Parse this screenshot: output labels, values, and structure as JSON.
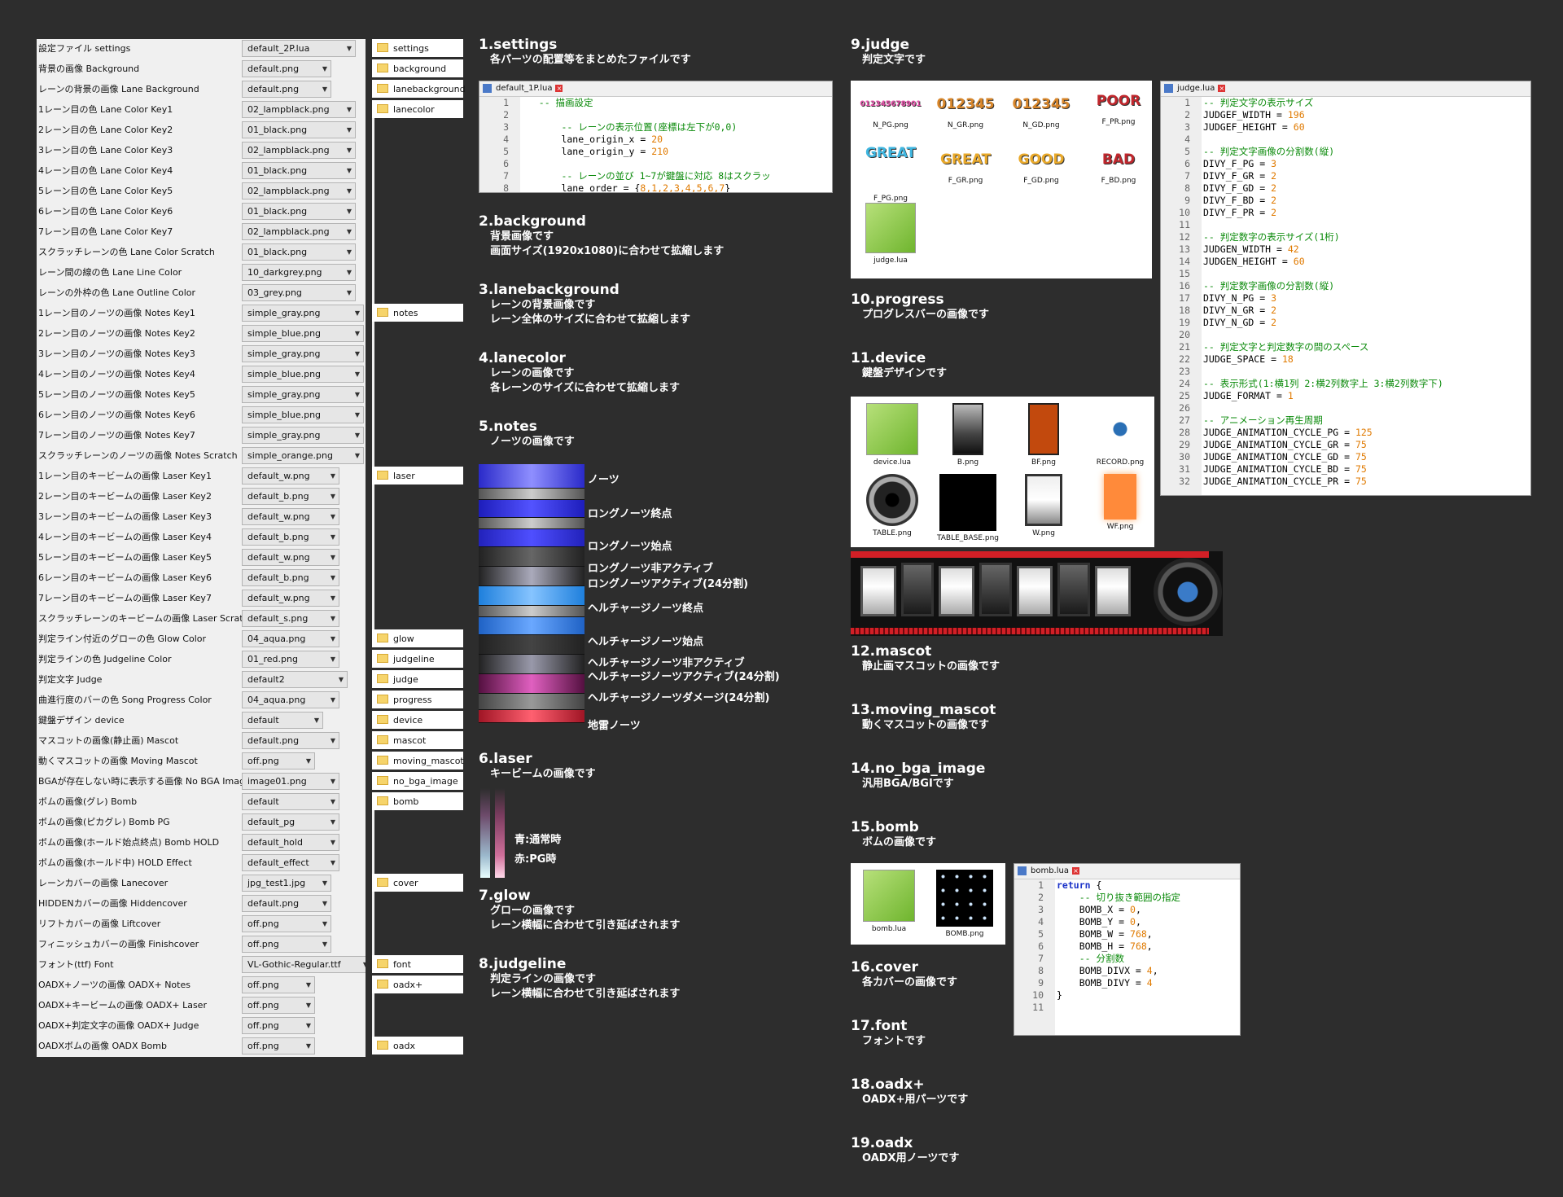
{
  "settings_rows": [
    {
      "label": "設定ファイル settings",
      "value": "default_2P.lua"
    },
    {
      "label": "背景の画像 Background",
      "value": "default.png"
    },
    {
      "label": "レーンの背景の画像 Lane Background",
      "value": "default.png"
    },
    {
      "label": "1レーン目の色 Lane Color Key1",
      "value": "02_lampblack.png"
    },
    {
      "label": "2レーン目の色 Lane Color Key2",
      "value": "01_black.png"
    },
    {
      "label": "3レーン目の色 Lane Color Key3",
      "value": "02_lampblack.png"
    },
    {
      "label": "4レーン目の色 Lane Color Key4",
      "value": "01_black.png"
    },
    {
      "label": "5レーン目の色 Lane Color Key5",
      "value": "02_lampblack.png"
    },
    {
      "label": "6レーン目の色 Lane Color Key6",
      "value": "01_black.png"
    },
    {
      "label": "7レーン目の色 Lane Color Key7",
      "value": "02_lampblack.png"
    },
    {
      "label": "スクラッチレーンの色 Lane Color Scratch",
      "value": "01_black.png"
    },
    {
      "label": "レーン間の線の色 Lane Line Color",
      "value": "10_darkgrey.png"
    },
    {
      "label": "レーンの外枠の色 Lane Outline Color",
      "value": "03_grey.png"
    },
    {
      "label": "1レーン目のノーツの画像 Notes Key1",
      "value": "simple_gray.png"
    },
    {
      "label": "2レーン目のノーツの画像 Notes Key2",
      "value": "simple_blue.png"
    },
    {
      "label": "3レーン目のノーツの画像 Notes Key3",
      "value": "simple_gray.png"
    },
    {
      "label": "4レーン目のノーツの画像 Notes Key4",
      "value": "simple_blue.png"
    },
    {
      "label": "5レーン目のノーツの画像 Notes Key5",
      "value": "simple_gray.png"
    },
    {
      "label": "6レーン目のノーツの画像 Notes Key6",
      "value": "simple_blue.png"
    },
    {
      "label": "7レーン目のノーツの画像 Notes Key7",
      "value": "simple_gray.png"
    },
    {
      "label": "スクラッチレーンのノーツの画像 Notes Scratch",
      "value": "simple_orange.png"
    },
    {
      "label": "1レーン目のキービームの画像 Laser Key1",
      "value": "default_w.png"
    },
    {
      "label": "2レーン目のキービームの画像 Laser Key2",
      "value": "default_b.png"
    },
    {
      "label": "3レーン目のキービームの画像 Laser Key3",
      "value": "default_w.png"
    },
    {
      "label": "4レーン目のキービームの画像 Laser Key4",
      "value": "default_b.png"
    },
    {
      "label": "5レーン目のキービームの画像 Laser Key5",
      "value": "default_w.png"
    },
    {
      "label": "6レーン目のキービームの画像 Laser Key6",
      "value": "default_b.png"
    },
    {
      "label": "7レーン目のキービームの画像 Laser Key7",
      "value": "default_w.png"
    },
    {
      "label": "スクラッチレーンのキービームの画像 Laser Scratch",
      "value": "default_s.png"
    },
    {
      "label": "判定ライン付近のグローの色 Glow Color",
      "value": "04_aqua.png"
    },
    {
      "label": "判定ラインの色 Judgeline Color",
      "value": "01_red.png"
    },
    {
      "label": "判定文字 Judge",
      "value": "default2"
    },
    {
      "label": "曲進行度のバーの色 Song Progress Color",
      "value": "04_aqua.png"
    },
    {
      "label": "鍵盤デザイン device",
      "value": "default"
    },
    {
      "label": "マスコットの画像(静止画) Mascot",
      "value": "default.png"
    },
    {
      "label": "動くマスコットの画像 Moving Mascot",
      "value": "off.png"
    },
    {
      "label": "BGAが存在しない時に表示する画像 No BGA Image",
      "value": "image01.png"
    },
    {
      "label": "ボムの画像(グレ) Bomb",
      "value": "default"
    },
    {
      "label": "ボムの画像(ピカグレ) Bomb PG",
      "value": "default_pg"
    },
    {
      "label": "ボムの画像(ホールド始点終点) Bomb HOLD",
      "value": "default_hold"
    },
    {
      "label": "ボムの画像(ホールド中) HOLD Effect",
      "value": "default_effect"
    },
    {
      "label": "レーンカバーの画像 Lanecover",
      "value": "jpg_test1.jpg"
    },
    {
      "label": "HIDDENカバーの画像 Hiddencover",
      "value": "default.png"
    },
    {
      "label": "リフトカバーの画像 Liftcover",
      "value": "off.png"
    },
    {
      "label": "フィニッシュカバーの画像 Finishcover",
      "value": "off.png"
    },
    {
      "label": "フォント(ttf) Font",
      "value": "VL-Gothic-Regular.ttf"
    },
    {
      "label": "OADX+ノーツの画像 OADX+ Notes",
      "value": "off.png"
    },
    {
      "label": "OADX+キービームの画像 OADX+ Laser",
      "value": "off.png"
    },
    {
      "label": "OADX+判定文字の画像 OADX+ Judge",
      "value": "off.png"
    },
    {
      "label": "OADXボムの画像 OADX Bomb",
      "value": "off.png"
    }
  ],
  "folders": [
    "settings",
    "background",
    "lanebackground",
    "lanecolor",
    "notes",
    "laser",
    "glow",
    "judgeline",
    "judge",
    "progress",
    "device",
    "mascot",
    "moving_mascot",
    "no_bga_image",
    "bomb",
    "cover",
    "font",
    "oadx+",
    "oadx"
  ],
  "sections_mid": [
    {
      "heading": "1.settings",
      "desc": [
        "各パーツの配置等をまとめたファイルです"
      ]
    },
    {
      "heading": "2.background",
      "desc": [
        "背景画像です",
        "画面サイズ(1920x1080)に合わせて拡縮します"
      ]
    },
    {
      "heading": "3.lanebackground",
      "desc": [
        "レーンの背景画像です",
        "レーン全体のサイズに合わせて拡縮します"
      ]
    },
    {
      "heading": "4.lanecolor",
      "desc": [
        "レーンの画像です",
        "各レーンのサイズに合わせて拡縮します"
      ]
    },
    {
      "heading": "5.notes",
      "desc": [
        "ノーツの画像です"
      ]
    },
    {
      "heading": "6.laser",
      "desc": [
        "キービームの画像です"
      ]
    },
    {
      "heading": "7.glow",
      "desc": [
        "グローの画像です",
        "レーン横幅に合わせて引き延ばされます"
      ]
    },
    {
      "heading": "8.judgeline",
      "desc": [
        "判定ラインの画像です",
        "レーン横幅に合わせて引き延ばされます"
      ]
    }
  ],
  "sections_right": [
    {
      "heading": "9.judge",
      "desc": [
        "判定文字です"
      ]
    },
    {
      "heading": "10.progress",
      "desc": [
        "プログレスバーの画像です"
      ]
    },
    {
      "heading": "11.device",
      "desc": [
        "鍵盤デザインです"
      ]
    },
    {
      "heading": "12.mascot",
      "desc": [
        "静止画マスコットの画像です"
      ]
    },
    {
      "heading": "13.moving_mascot",
      "desc": [
        "動くマスコットの画像です"
      ]
    },
    {
      "heading": "14.no_bga_image",
      "desc": [
        "汎用BGA/BGIです"
      ]
    },
    {
      "heading": "15.bomb",
      "desc": [
        "ボムの画像です"
      ]
    },
    {
      "heading": "16.cover",
      "desc": [
        "各カバーの画像です"
      ]
    },
    {
      "heading": "17.font",
      "desc": [
        "フォントです"
      ]
    },
    {
      "heading": "18.oadx+",
      "desc": [
        "OADX+用パーツです"
      ]
    },
    {
      "heading": "19.oadx",
      "desc": [
        "OADX用ノーツです"
      ]
    }
  ],
  "notes_labels": [
    "ノーツ",
    "ロングノーツ終点",
    "ロングノーツ始点",
    "ロングノーツ非アクティブ",
    "ロングノーツアクティブ(24分割)",
    "ヘルチャージノーツ終点",
    "ヘルチャージノーツ始点",
    "ヘルチャージノーツ非アクティブ",
    "ヘルチャージノーツアクティブ(24分割)",
    "ヘルチャージノーツダメージ(24分割)",
    "地雷ノーツ"
  ],
  "laser_labels": [
    "青:通常時",
    "赤:PG時"
  ],
  "settings_file": {
    "tab": "default_1P.lua",
    "lines": [
      {
        "n": "1",
        "parts": [
          {
            "t": "   "
          },
          {
            "c": "cm",
            "t": "-- 描画設定"
          }
        ]
      },
      {
        "n": "2",
        "parts": [
          {
            "t": ""
          }
        ]
      },
      {
        "n": "3",
        "parts": [
          {
            "t": "       "
          },
          {
            "c": "cm",
            "t": "-- レーンの表示位置(座標は左下が0,0)"
          }
        ]
      },
      {
        "n": "4",
        "parts": [
          {
            "t": "       lane_origin_x = "
          },
          {
            "c": "num",
            "t": "20"
          }
        ]
      },
      {
        "n": "5",
        "parts": [
          {
            "t": "       lane_origin_y = "
          },
          {
            "c": "num",
            "t": "210"
          }
        ]
      },
      {
        "n": "6",
        "parts": [
          {
            "t": ""
          }
        ]
      },
      {
        "n": "7",
        "parts": [
          {
            "t": "       "
          },
          {
            "c": "cm",
            "t": "-- レーンの並び 1~7が鍵盤に対応 8はスクラッ"
          }
        ]
      },
      {
        "n": "8",
        "parts": [
          {
            "t": "       lane_order = {"
          },
          {
            "c": "num",
            "t": "8,1,2,3,4,5,6,7"
          },
          {
            "t": "}"
          }
        ]
      }
    ]
  },
  "judge_file": {
    "tab": "judge.lua",
    "lines": [
      {
        "n": "1",
        "parts": [
          {
            "c": "cm",
            "t": "-- 判定文字の表示サイズ"
          }
        ]
      },
      {
        "n": "2",
        "parts": [
          {
            "t": "JUDGEF_WIDTH = "
          },
          {
            "c": "num",
            "t": "196"
          }
        ]
      },
      {
        "n": "3",
        "parts": [
          {
            "t": "JUDGEF_HEIGHT = "
          },
          {
            "c": "num",
            "t": "60"
          }
        ]
      },
      {
        "n": "4",
        "parts": [
          {
            "t": ""
          }
        ]
      },
      {
        "n": "5",
        "parts": [
          {
            "c": "cm",
            "t": "-- 判定文字画像の分割数(縦)"
          }
        ]
      },
      {
        "n": "6",
        "parts": [
          {
            "t": "DIVY_F_PG = "
          },
          {
            "c": "num",
            "t": "3"
          }
        ]
      },
      {
        "n": "7",
        "parts": [
          {
            "t": "DIVY_F_GR = "
          },
          {
            "c": "num",
            "t": "2"
          }
        ]
      },
      {
        "n": "8",
        "parts": [
          {
            "t": "DIVY_F_GD = "
          },
          {
            "c": "num",
            "t": "2"
          }
        ]
      },
      {
        "n": "9",
        "parts": [
          {
            "t": "DIVY_F_BD = "
          },
          {
            "c": "num",
            "t": "2"
          }
        ]
      },
      {
        "n": "10",
        "parts": [
          {
            "t": "DIVY_F_PR = "
          },
          {
            "c": "num",
            "t": "2"
          }
        ]
      },
      {
        "n": "11",
        "parts": [
          {
            "t": ""
          }
        ]
      },
      {
        "n": "12",
        "parts": [
          {
            "c": "cm",
            "t": "-- 判定数字の表示サイズ(1桁)"
          }
        ]
      },
      {
        "n": "13",
        "parts": [
          {
            "t": "JUDGEN_WIDTH = "
          },
          {
            "c": "num",
            "t": "42"
          }
        ]
      },
      {
        "n": "14",
        "parts": [
          {
            "t": "JUDGEN_HEIGHT = "
          },
          {
            "c": "num",
            "t": "60"
          }
        ]
      },
      {
        "n": "15",
        "parts": [
          {
            "t": ""
          }
        ]
      },
      {
        "n": "16",
        "parts": [
          {
            "c": "cm",
            "t": "-- 判定数字画像の分割数(縦)"
          }
        ]
      },
      {
        "n": "17",
        "parts": [
          {
            "t": "DIVY_N_PG = "
          },
          {
            "c": "num",
            "t": "3"
          }
        ]
      },
      {
        "n": "18",
        "parts": [
          {
            "t": "DIVY_N_GR = "
          },
          {
            "c": "num",
            "t": "2"
          }
        ]
      },
      {
        "n": "19",
        "parts": [
          {
            "t": "DIVY_N_GD = "
          },
          {
            "c": "num",
            "t": "2"
          }
        ]
      },
      {
        "n": "20",
        "parts": [
          {
            "t": ""
          }
        ]
      },
      {
        "n": "21",
        "parts": [
          {
            "c": "cm",
            "t": "-- 判定文字と判定数字の間のスペース"
          }
        ]
      },
      {
        "n": "22",
        "parts": [
          {
            "t": "JUDGE_SPACE = "
          },
          {
            "c": "num",
            "t": "18"
          }
        ]
      },
      {
        "n": "23",
        "parts": [
          {
            "t": ""
          }
        ]
      },
      {
        "n": "24",
        "parts": [
          {
            "c": "cm",
            "t": "-- 表示形式(1:横1列 2:横2列数字上 3:横2列数字下)"
          }
        ]
      },
      {
        "n": "25",
        "parts": [
          {
            "t": "JUDGE_FORMAT = "
          },
          {
            "c": "num",
            "t": "1"
          }
        ]
      },
      {
        "n": "26",
        "parts": [
          {
            "t": ""
          }
        ]
      },
      {
        "n": "27",
        "parts": [
          {
            "c": "cm",
            "t": "-- アニメーション再生周期"
          }
        ]
      },
      {
        "n": "28",
        "parts": [
          {
            "t": "JUDGE_ANIMATION_CYCLE_PG = "
          },
          {
            "c": "num",
            "t": "125"
          }
        ]
      },
      {
        "n": "29",
        "parts": [
          {
            "t": "JUDGE_ANIMATION_CYCLE_GR = "
          },
          {
            "c": "num",
            "t": "75"
          }
        ]
      },
      {
        "n": "30",
        "parts": [
          {
            "t": "JUDGE_ANIMATION_CYCLE_GD = "
          },
          {
            "c": "num",
            "t": "75"
          }
        ]
      },
      {
        "n": "31",
        "parts": [
          {
            "t": "JUDGE_ANIMATION_CYCLE_BD = "
          },
          {
            "c": "num",
            "t": "75"
          }
        ]
      },
      {
        "n": "32",
        "parts": [
          {
            "t": "JUDGE_ANIMATION_CYCLE_PR = "
          },
          {
            "c": "num",
            "t": "75"
          }
        ]
      }
    ]
  },
  "bomb_file": {
    "tab": "bomb.lua",
    "lines": [
      {
        "n": "1",
        "parts": [
          {
            "c": "kw",
            "t": "return"
          },
          {
            "t": " {"
          }
        ]
      },
      {
        "n": "2",
        "parts": [
          {
            "t": "    "
          },
          {
            "c": "cm",
            "t": "-- 切り抜き範囲の指定"
          }
        ]
      },
      {
        "n": "3",
        "parts": [
          {
            "t": "    BOMB_X = "
          },
          {
            "c": "num",
            "t": "0"
          },
          {
            "t": ","
          }
        ]
      },
      {
        "n": "4",
        "parts": [
          {
            "t": "    BOMB_Y = "
          },
          {
            "c": "num",
            "t": "0"
          },
          {
            "t": ","
          }
        ]
      },
      {
        "n": "5",
        "parts": [
          {
            "t": "    BOMB_W = "
          },
          {
            "c": "num",
            "t": "768"
          },
          {
            "t": ","
          }
        ]
      },
      {
        "n": "6",
        "parts": [
          {
            "t": "    BOMB_H = "
          },
          {
            "c": "num",
            "t": "768"
          },
          {
            "t": ","
          }
        ]
      },
      {
        "n": "7",
        "parts": [
          {
            "t": "    "
          },
          {
            "c": "cm",
            "t": "-- 分割数"
          }
        ]
      },
      {
        "n": "8",
        "parts": [
          {
            "t": "    BOMB_DIVX = "
          },
          {
            "c": "num",
            "t": "4"
          },
          {
            "t": ","
          }
        ]
      },
      {
        "n": "9",
        "parts": [
          {
            "t": "    BOMB_DIVY = "
          },
          {
            "c": "num",
            "t": "4"
          }
        ]
      },
      {
        "n": "10",
        "parts": [
          {
            "t": "}"
          }
        ]
      },
      {
        "n": "11",
        "parts": [
          {
            "t": ""
          }
        ]
      }
    ]
  },
  "judge_thumbs": [
    {
      "name": "N_PG.png",
      "art": "01234567890123456789",
      "color": "#e64ea9"
    },
    {
      "name": "N_GR.png",
      "art": "0123456789",
      "color": "#d8862a"
    },
    {
      "name": "N_GD.png",
      "art": "0123456789",
      "color": "#d8862a"
    },
    {
      "name": "F_PR.png",
      "art": "POOR",
      "color": "#c0272d"
    },
    {
      "name": "F_PG.png",
      "art": "GREAT",
      "color": "#3fb6e0"
    },
    {
      "name": "F_GR.png",
      "art": "GREAT",
      "color": "#e9a92a"
    },
    {
      "name": "F_GD.png",
      "art": "GOOD",
      "color": "#e9a92a"
    },
    {
      "name": "F_BD.png",
      "art": "BAD",
      "color": "#c0272d"
    },
    {
      "name": "judge.lua",
      "art": "notepad++-icon",
      "color": "#7ac143"
    }
  ],
  "device_thumbs": [
    {
      "name": "device.lua",
      "art": "notepad++-icon"
    },
    {
      "name": "B.png",
      "art": "black-key"
    },
    {
      "name": "BF.png",
      "art": "orange-key"
    },
    {
      "name": "RECORD.png",
      "art": "record-dot"
    },
    {
      "name": "TABLE.png",
      "art": "turntable"
    },
    {
      "name": "TABLE_BASE.png",
      "art": "black-square"
    },
    {
      "name": "W.png",
      "art": "white-key"
    },
    {
      "name": "WF.png",
      "art": "orange-glow"
    }
  ],
  "bomb_thumbs": [
    {
      "name": "bomb.lua",
      "art": "notepad++-icon"
    },
    {
      "name": "BOMB.png",
      "art": "bomb-grid"
    }
  ]
}
